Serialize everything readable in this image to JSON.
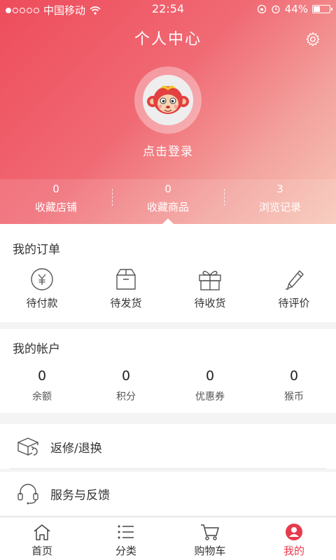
{
  "status_bar": {
    "carrier": "中国移动",
    "time": "22:54",
    "battery": "44%",
    "battery_level": 0.44
  },
  "header": {
    "title": "个人中心",
    "login_text": "点击登录"
  },
  "stats": [
    {
      "value": "0",
      "label": "收藏店铺"
    },
    {
      "value": "0",
      "label": "收藏商品"
    },
    {
      "value": "3",
      "label": "浏览记录"
    }
  ],
  "orders": {
    "title": "我的订单",
    "items": [
      {
        "label": "待付款",
        "icon": "yuan-coin-icon"
      },
      {
        "label": "待发货",
        "icon": "box-icon"
      },
      {
        "label": "待收货",
        "icon": "gift-icon"
      },
      {
        "label": "待评价",
        "icon": "pen-icon"
      }
    ]
  },
  "account": {
    "title": "我的帐户",
    "items": [
      {
        "value": "0",
        "label": "余额"
      },
      {
        "value": "0",
        "label": "积分"
      },
      {
        "value": "0",
        "label": "优惠券"
      },
      {
        "value": "0",
        "label": "猴币"
      }
    ]
  },
  "menu": [
    {
      "label": "返修/退换",
      "icon": "return-box-icon"
    },
    {
      "label": "服务与反馈",
      "icon": "headset-icon"
    }
  ],
  "tabbar": [
    {
      "label": "首页",
      "icon": "home-icon"
    },
    {
      "label": "分类",
      "icon": "list-icon"
    },
    {
      "label": "购物车",
      "icon": "cart-icon"
    },
    {
      "label": "我的",
      "icon": "user-icon",
      "active": true
    }
  ],
  "colors": {
    "accent": "#e83a4d",
    "header_start": "#ee4c5b",
    "header_end": "#f7c7b8"
  }
}
